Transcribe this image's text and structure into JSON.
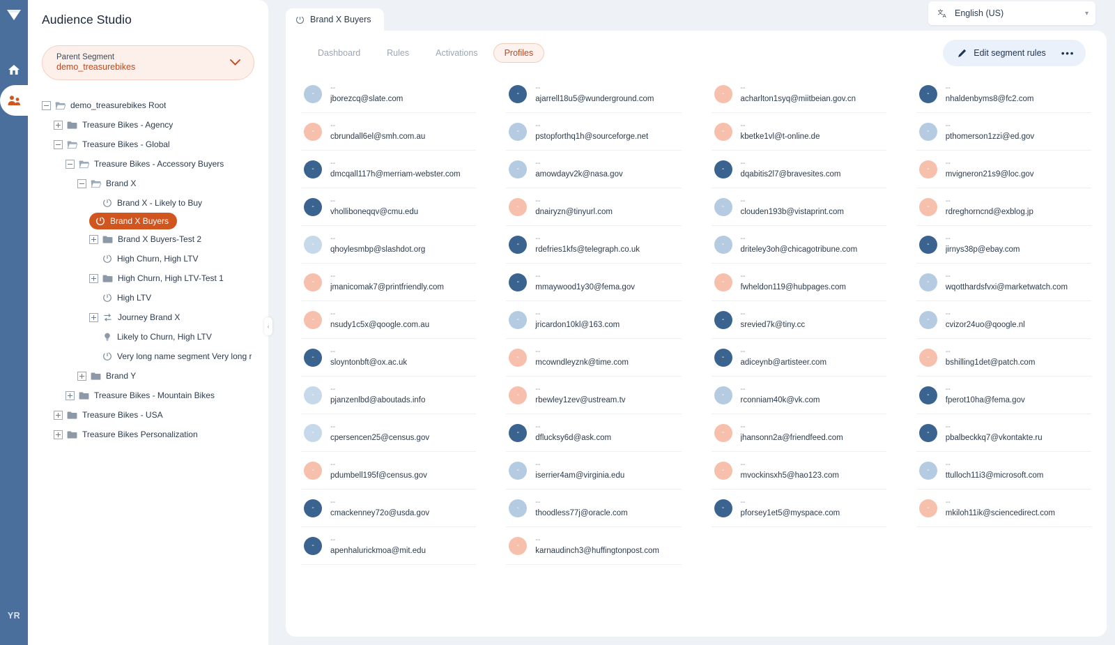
{
  "rail": {
    "logo_icon": "diamond-logo-icon",
    "items": [
      {
        "name": "home",
        "icon": "home-icon"
      },
      {
        "name": "audience",
        "icon": "audience-people-icon"
      }
    ],
    "avatar_initials": "YR"
  },
  "sidebar": {
    "title": "Audience Studio",
    "parent_segment": {
      "label": "Parent Segment",
      "value": "demo_treasurebikes",
      "caret_icon": "chevron-down-icon"
    },
    "tree": [
      {
        "label": "demo_treasurebikes Root",
        "depth": 0,
        "twist": "minus",
        "icon": "folder-open-icon",
        "selected": false
      },
      {
        "label": "Treasure Bikes - Agency",
        "depth": 1,
        "twist": "plus",
        "icon": "folder-icon",
        "selected": false
      },
      {
        "label": "Treasure Bikes - Global",
        "depth": 1,
        "twist": "minus",
        "icon": "folder-open-icon",
        "selected": false
      },
      {
        "label": "Treasure Bikes - Accessory Buyers",
        "depth": 2,
        "twist": "minus",
        "icon": "folder-open-icon",
        "selected": false
      },
      {
        "label": "Brand X",
        "depth": 3,
        "twist": "minus",
        "icon": "folder-open-icon",
        "selected": false
      },
      {
        "label": "Brand X - Likely to Buy",
        "depth": 4,
        "twist": "none",
        "icon": "segment-icon",
        "selected": false
      },
      {
        "label": "Brand X Buyers",
        "depth": 4,
        "twist": "none",
        "icon": "segment-icon",
        "selected": true
      },
      {
        "label": "Brand X Buyers-Test 2",
        "depth": 4,
        "twist": "plus",
        "icon": "folder-icon",
        "selected": false
      },
      {
        "label": "High Churn, High LTV",
        "depth": 4,
        "twist": "none",
        "icon": "segment-icon",
        "selected": false
      },
      {
        "label": "High Churn, High LTV-Test 1",
        "depth": 4,
        "twist": "plus",
        "icon": "folder-icon",
        "selected": false
      },
      {
        "label": "High LTV",
        "depth": 4,
        "twist": "none",
        "icon": "segment-icon",
        "selected": false
      },
      {
        "label": "Journey Brand X",
        "depth": 4,
        "twist": "plus",
        "icon": "journey-icon",
        "selected": false
      },
      {
        "label": "Likely to Churn, High LTV",
        "depth": 4,
        "twist": "none",
        "icon": "lookalike-icon",
        "selected": false
      },
      {
        "label": "Very long name segment Very long r",
        "depth": 4,
        "twist": "none",
        "icon": "segment-icon",
        "selected": false
      },
      {
        "label": "Brand Y",
        "depth": 3,
        "twist": "plus",
        "icon": "folder-icon",
        "selected": false
      },
      {
        "label": "Treasure Bikes - Mountain Bikes",
        "depth": 2,
        "twist": "plus",
        "icon": "folder-icon",
        "selected": false
      },
      {
        "label": "Treasure Bikes - USA",
        "depth": 1,
        "twist": "plus",
        "icon": "folder-icon",
        "selected": false
      },
      {
        "label": "Treasure Bikes Personalization",
        "depth": 1,
        "twist": "plus",
        "icon": "folder-icon",
        "selected": false
      }
    ],
    "collapse_grip_icon": "chevron-left-icon"
  },
  "topbar": {
    "language": {
      "value": "English (US)",
      "icon": "translate-icon",
      "caret_icon": "chevron-down-icon"
    },
    "segment_tab": {
      "label": "Brand X Buyers",
      "icon": "segment-icon"
    }
  },
  "content": {
    "tabs": [
      {
        "label": "Dashboard",
        "active": false
      },
      {
        "label": "Rules",
        "active": false
      },
      {
        "label": "Activations",
        "active": false
      },
      {
        "label": "Profiles",
        "active": true
      }
    ],
    "edit_button": {
      "label": "Edit segment rules",
      "icon": "pencil-icon",
      "more_icon": "ellipsis-icon",
      "more_label": "•••"
    }
  },
  "colors": {
    "accent_orange": "#c1471c",
    "selected_orange": "#d1551f",
    "rail_blue": "#4a6f9c",
    "button_blue_bg": "#eaf1fa",
    "avatar_dark_blue": "#3a648f",
    "avatar_light_blue": "#b4cbe2",
    "avatar_peach": "#f6c0ac"
  },
  "profiles": {
    "placeholder_name": "--",
    "columns": [
      [
        {
          "email": "jborezcq@slate.com",
          "avatar": "#b4cbe2"
        },
        {
          "email": "cbrundall6el@smh.com.au",
          "avatar": "#f6c0ac"
        },
        {
          "email": "dmcqall117h@merriam-webster.com",
          "avatar": "#3a648f"
        },
        {
          "email": "vholliboneqqv@cmu.edu",
          "avatar": "#3a648f"
        },
        {
          "email": "qhoylesmbp@slashdot.org",
          "avatar": "#c6d9ea"
        },
        {
          "email": "jmanicomak7@printfriendly.com",
          "avatar": "#f6c0ac"
        },
        {
          "email": "nsudy1c5x@qoogle.com.au",
          "avatar": "#f6c0ac"
        },
        {
          "email": "sloyntonbft@ox.ac.uk",
          "avatar": "#3a648f"
        },
        {
          "email": "pjanzenlbd@aboutads.info",
          "avatar": "#c6d9ea"
        },
        {
          "email": "cpersencen25@census.gov",
          "avatar": "#c6d9ea"
        },
        {
          "email": "pdumbell195f@census.gov",
          "avatar": "#f6c0ac"
        },
        {
          "email": "cmackenney72o@usda.gov",
          "avatar": "#3a648f"
        },
        {
          "email": "apenhalurickmoa@mit.edu",
          "avatar": "#3a648f"
        }
      ],
      [
        {
          "email": "ajarrell18u5@wunderground.com",
          "avatar": "#3a648f"
        },
        {
          "email": "pstopforthq1h@sourceforge.net",
          "avatar": "#b4cbe2"
        },
        {
          "email": "amowdayv2k@nasa.gov",
          "avatar": "#b4cbe2"
        },
        {
          "email": "dnairyzn@tinyurl.com",
          "avatar": "#f6c0ac"
        },
        {
          "email": "rdefries1kfs@telegraph.co.uk",
          "avatar": "#3a648f"
        },
        {
          "email": "mmaywood1y30@fema.gov",
          "avatar": "#3a648f"
        },
        {
          "email": "jricardon10kl@163.com",
          "avatar": "#b4cbe2"
        },
        {
          "email": "mcowndleyznk@time.com",
          "avatar": "#f6c0ac"
        },
        {
          "email": "rbewley1zev@ustream.tv",
          "avatar": "#f6c0ac"
        },
        {
          "email": "dflucksy6d@ask.com",
          "avatar": "#3a648f"
        },
        {
          "email": "iserrier4am@virginia.edu",
          "avatar": "#b4cbe2"
        },
        {
          "email": "thoodless77j@oracle.com",
          "avatar": "#b4cbe2"
        },
        {
          "email": "karnaudinch3@huffingtonpost.com",
          "avatar": "#f6c0ac"
        }
      ],
      [
        {
          "email": "acharlton1syq@miitbeian.gov.cn",
          "avatar": "#f6c0ac"
        },
        {
          "email": "kbetke1vl@t-online.de",
          "avatar": "#f6c0ac"
        },
        {
          "email": "dqabitis2l7@bravesites.com",
          "avatar": "#3a648f"
        },
        {
          "email": "clouden193b@vistaprint.com",
          "avatar": "#b4cbe2"
        },
        {
          "email": "driteley3oh@chicagotribune.com",
          "avatar": "#b4cbe2"
        },
        {
          "email": "fwheldon119@hubpages.com",
          "avatar": "#f6c0ac"
        },
        {
          "email": "srevied7k@tiny.cc",
          "avatar": "#3a648f"
        },
        {
          "email": "adiceynb@artisteer.com",
          "avatar": "#3a648f"
        },
        {
          "email": "rconniam40k@vk.com",
          "avatar": "#b4cbe2"
        },
        {
          "email": "jhansonn2a@friendfeed.com",
          "avatar": "#f6c0ac"
        },
        {
          "email": "mvockinsxh5@hao123.com",
          "avatar": "#f6c0ac"
        },
        {
          "email": "pforsey1et5@myspace.com",
          "avatar": "#3a648f"
        }
      ],
      [
        {
          "email": "nhaldenbyms8@fc2.com",
          "avatar": "#3a648f"
        },
        {
          "email": "pthomerson1zzi@ed.gov",
          "avatar": "#b4cbe2"
        },
        {
          "email": "mvigneron21s9@loc.gov",
          "avatar": "#f6c0ac"
        },
        {
          "email": "rdreghorncnd@exblog.jp",
          "avatar": "#f6c0ac"
        },
        {
          "email": "jirnys38p@ebay.com",
          "avatar": "#3a648f"
        },
        {
          "email": "wqotthardsfvxi@marketwatch.com",
          "avatar": "#b4cbe2"
        },
        {
          "email": "cvizor24uo@qoogle.nl",
          "avatar": "#b4cbe2"
        },
        {
          "email": "bshilling1det@patch.com",
          "avatar": "#f6c0ac"
        },
        {
          "email": "fperot10ha@fema.gov",
          "avatar": "#3a648f"
        },
        {
          "email": "pbalbeckkq7@vkontakte.ru",
          "avatar": "#3a648f"
        },
        {
          "email": "ttulloch11i3@microsoft.com",
          "avatar": "#b4cbe2"
        },
        {
          "email": "mkiloh11ik@sciencedirect.com",
          "avatar": "#f6c0ac"
        }
      ]
    ]
  }
}
